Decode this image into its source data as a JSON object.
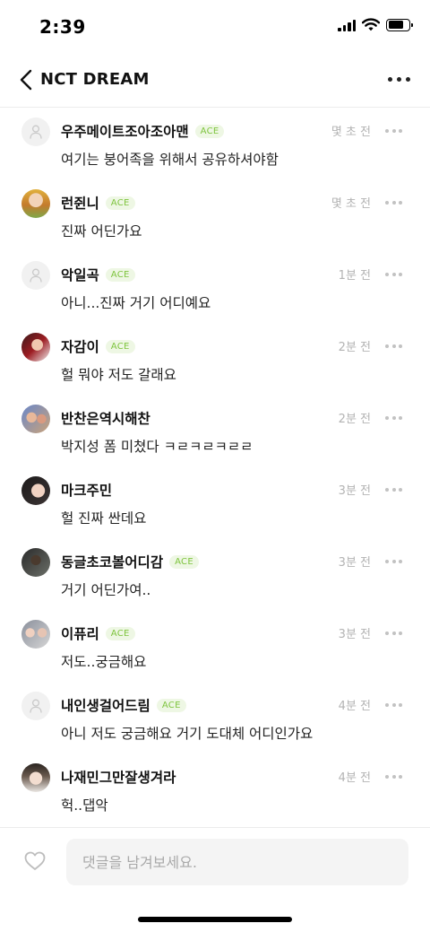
{
  "status_bar": {
    "time": "2:39"
  },
  "header": {
    "title": "NCT DREAM"
  },
  "comments": [
    {
      "username": "우주메이트조아조아맨",
      "badge": "ACE",
      "time": "몇 초 전",
      "text": "여기는 붕어족을 위해서 공유하셔야함",
      "avatar": "default"
    },
    {
      "username": "런쥔니",
      "badge": "ACE",
      "time": "몇 초 전",
      "text": "진짜 어딘가요",
      "avatar": "photo"
    },
    {
      "username": "악일곡",
      "badge": "ACE",
      "time": "1분 전",
      "text": "아니...진짜 거기 어디예요",
      "avatar": "default"
    },
    {
      "username": "자감이",
      "badge": "ACE",
      "time": "2분 전",
      "text": "헐 뭐야 저도 갈래요",
      "avatar": "photo"
    },
    {
      "username": "반찬은역시해찬",
      "badge": "",
      "time": "2분 전",
      "text": "박지성 폼 미쳤다 ㅋㄹㅋㄹㅋㄹㄹ",
      "avatar": "photo"
    },
    {
      "username": "마크주민",
      "badge": "",
      "time": "3분 전",
      "text": "헐 진짜 싼데요",
      "avatar": "photo"
    },
    {
      "username": "동글초코볼어디감",
      "badge": "ACE",
      "time": "3분 전",
      "text": "거기 어딘가여..",
      "avatar": "photo"
    },
    {
      "username": "이퓨리",
      "badge": "ACE",
      "time": "3분 전",
      "text": "저도..궁금해요",
      "avatar": "photo"
    },
    {
      "username": "내인생걸어드림",
      "badge": "ACE",
      "time": "4분 전",
      "text": "아니 저도 궁금해요 거기 도대체 어디인가요",
      "avatar": "default"
    },
    {
      "username": "나재민그만잘생겨라",
      "badge": "",
      "time": "4분 전",
      "text": "헉..댑악",
      "avatar": "photo"
    }
  ],
  "input": {
    "placeholder": "댓글을 남겨보세요."
  },
  "colors": {
    "badge_text": "#7ec43e",
    "badge_bg": "#eef7e4",
    "time": "#b3b3b3"
  },
  "icons": {
    "back": "chevron-left-icon",
    "more": "more-horizontal-icon",
    "like": "heart-outline-icon",
    "default_avatar": "user-icon"
  }
}
